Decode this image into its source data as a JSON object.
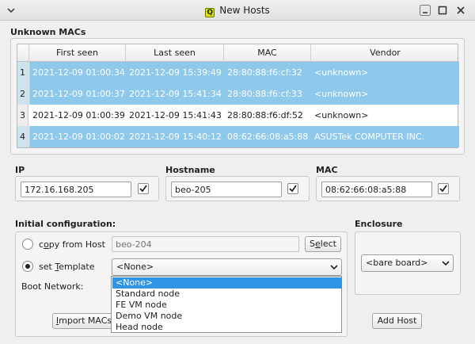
{
  "window": {
    "title": "New Hosts",
    "logo_letter": "Q"
  },
  "unknown_macs": {
    "label": "Unknown MACs",
    "columns": [
      "First seen",
      "Last seen",
      "MAC",
      "Vendor"
    ],
    "rows": [
      {
        "num": "1",
        "first_seen": "2021-12-09 01:00:34",
        "last_seen": "2021-12-09 15:39:49",
        "mac": "28:80:88:f6:cf:32",
        "vendor": "<unknown>",
        "selected": true
      },
      {
        "num": "2",
        "first_seen": "2021-12-09 01:00:37",
        "last_seen": "2021-12-09 15:41:34",
        "mac": "28:80:88:f6:cf:33",
        "vendor": "<unknown>",
        "selected": true
      },
      {
        "num": "3",
        "first_seen": "2021-12-09 01:00:39",
        "last_seen": "2021-12-09 15:41:43",
        "mac": "28:80:88:f6:df:52",
        "vendor": "<unknown>",
        "selected": false
      },
      {
        "num": "4",
        "first_seen": "2021-12-09 01:00:02",
        "last_seen": "2021-12-09 15:40:12",
        "mac": "08:62:66:08:a5:88",
        "vendor": "ASUSTek COMPUTER INC.",
        "selected": true
      }
    ]
  },
  "ip": {
    "label": "IP",
    "value": "172.16.168.205",
    "checked": true
  },
  "hostname": {
    "label": "Hostname",
    "value": "beo-205",
    "checked": true
  },
  "mac": {
    "label": "MAC",
    "value": "08:62:66:08:a5:88",
    "checked": true
  },
  "initial_config": {
    "label": "Initial configuration:",
    "copy_from_host": {
      "label_pre": "c",
      "label_u": "o",
      "label_post": "py from Host",
      "placeholder": "beo-204",
      "selected": false
    },
    "select_button": {
      "pre": "S",
      "u": "e",
      "post": "lect"
    },
    "set_template": {
      "label_pre": "set ",
      "label_u": "T",
      "label_post": "emplate",
      "value": "<None>",
      "selected": true
    },
    "boot_network_label": "Boot Network:",
    "template_options": [
      "<None>",
      "Standard node",
      "FE VM node",
      "Demo VM node",
      "Head node"
    ],
    "selected_option_index": 0
  },
  "enclosure": {
    "label": "Enclosure",
    "value": "<bare board>"
  },
  "buttons": {
    "import_macs": {
      "u": "I",
      "post": "mport MACs"
    },
    "add_host": "Add Host"
  },
  "colors": {
    "selection": "#8ec8ea",
    "highlight": "#2f95e4",
    "logo": "#d7e600"
  }
}
